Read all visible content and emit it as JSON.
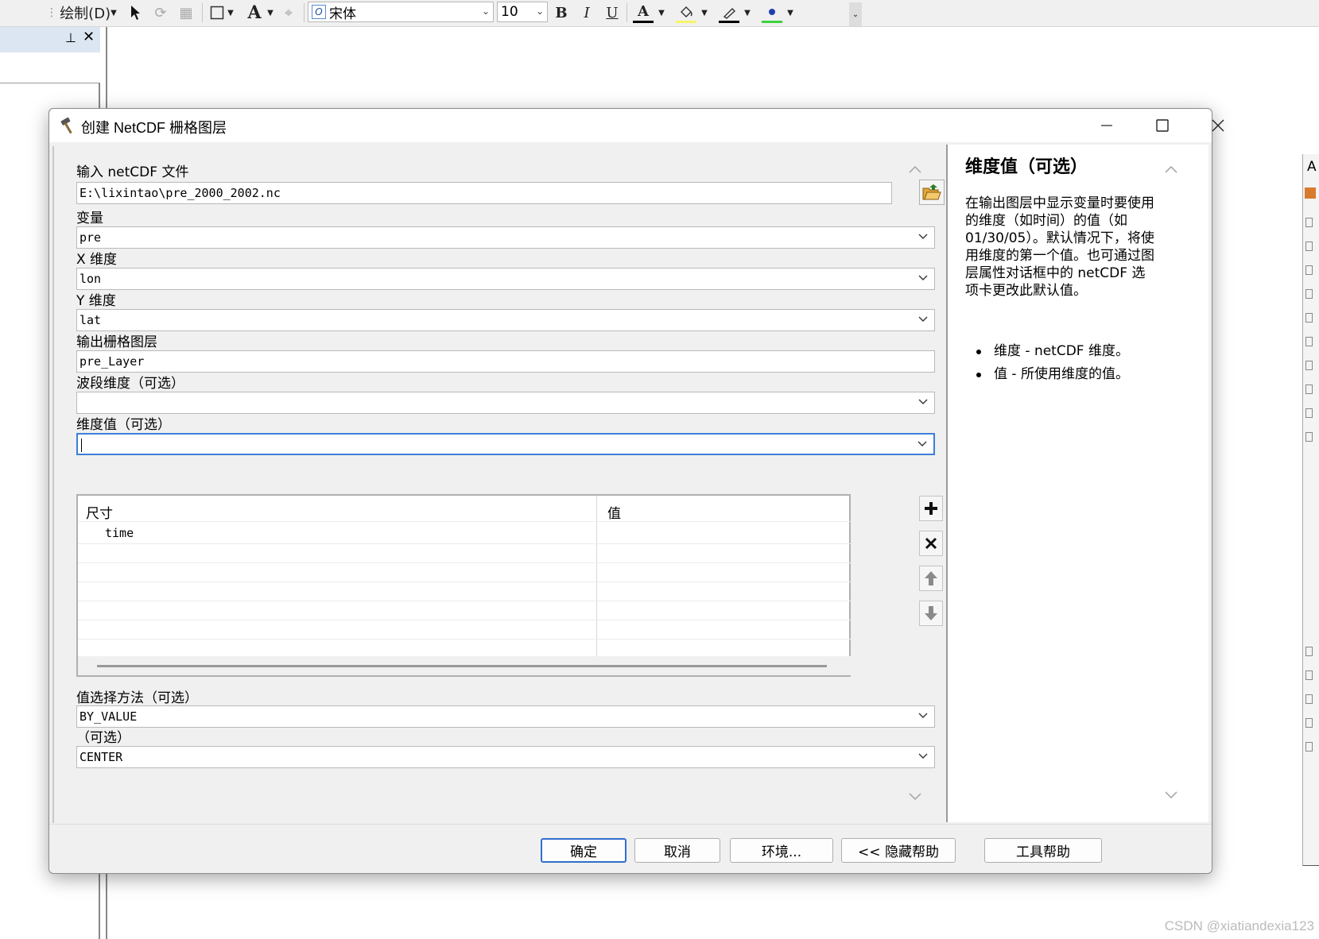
{
  "app": {
    "draw_menu": "绘制(D)",
    "font_name": "宋体",
    "font_size": "10",
    "bold": "B",
    "italic": "I",
    "underline": "U",
    "font_color": "A",
    "right_dock_letter": "A"
  },
  "dialog": {
    "title": "创建 NetCDF 栅格图层",
    "fields": {
      "input_file": {
        "label": "输入 netCDF 文件",
        "value": "E:\\lixintao\\pre_2000_2002.nc"
      },
      "variable": {
        "label": "变量",
        "value": "pre"
      },
      "x_dim": {
        "label": "X 维度",
        "value": "lon"
      },
      "y_dim": {
        "label": "Y 维度",
        "value": "lat"
      },
      "out_layer": {
        "label": "输出栅格图层",
        "value": "pre_Layer"
      },
      "band_dim": {
        "label": "波段维度（可选）",
        "value": ""
      },
      "dim_values": {
        "label": "维度值（可选）",
        "value": ""
      },
      "value_method": {
        "label": "值选择方法（可选）",
        "value": "BY_VALUE"
      },
      "cell_reg": {
        "label": "（可选）",
        "value": "CENTER"
      }
    },
    "table": {
      "headers": [
        "尺寸",
        "值"
      ],
      "rows": [
        {
          "dim": "time",
          "value": ""
        }
      ]
    },
    "buttons": {
      "ok": "确定",
      "cancel": "取消",
      "env": "环境...",
      "hide_help": "<< 隐藏帮助",
      "tool_help": "工具帮助"
    },
    "help": {
      "title": "维度值（可选）",
      "body": "在输出图层中显示变量时要使用的维度（如时间）的值（如 01/30/05）。默认情况下，将使用维度的第一个值。也可通过图层属性对话框中的 netCDF 选项卡更改此默认值。",
      "items": [
        "维度 - netCDF 维度。",
        "值 - 所使用维度的值。"
      ]
    }
  },
  "watermark": "CSDN @xiatiandexia123",
  "colors": {
    "focus": "#3c7fd7",
    "default_button": "#2f6fcc",
    "folder_icon": "#e0a53a"
  }
}
